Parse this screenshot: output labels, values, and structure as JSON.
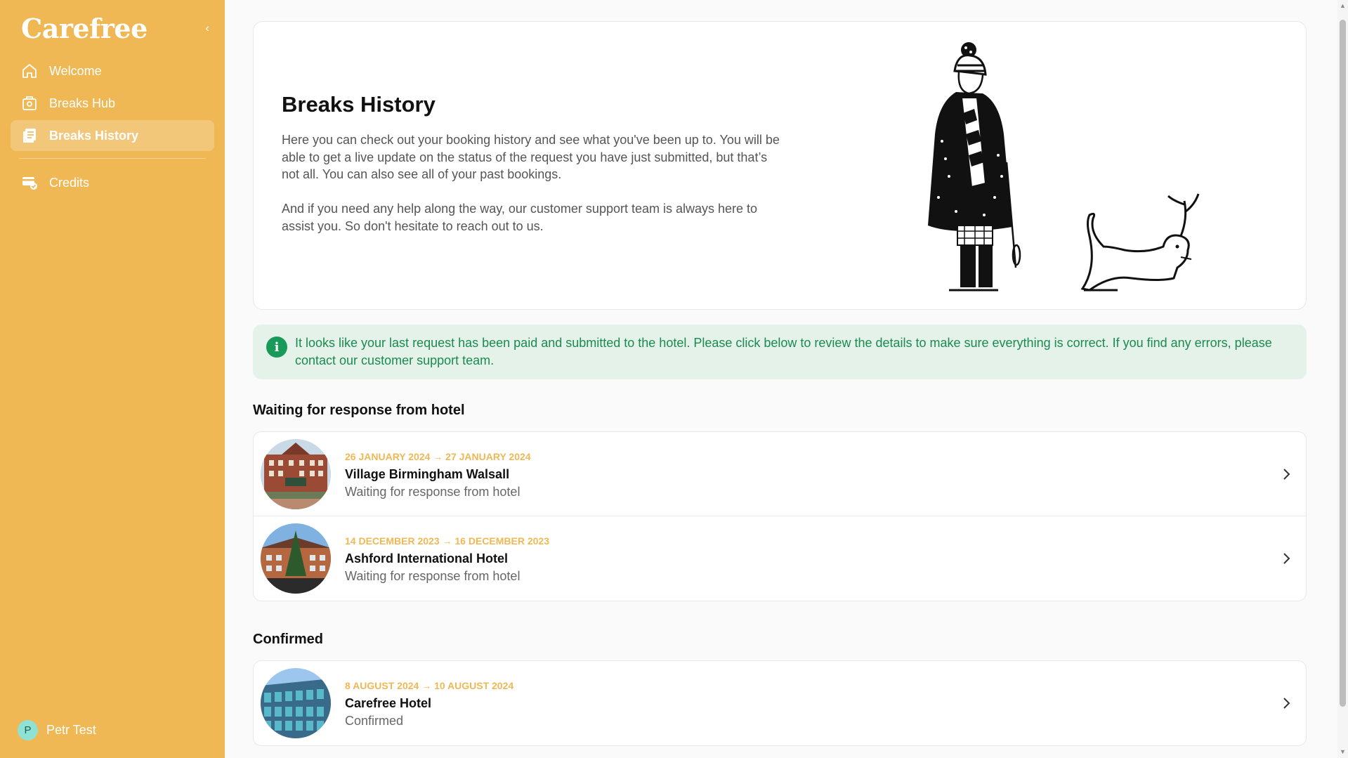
{
  "app": {
    "logo": "Carefree"
  },
  "sidebar": {
    "collapse_icon": "chevron-left-icon",
    "items": [
      {
        "label": "Welcome",
        "icon": "home-icon",
        "active": false
      },
      {
        "label": "Breaks Hub",
        "icon": "suitcase-icon",
        "active": false
      },
      {
        "label": "Breaks History",
        "icon": "history-list-icon",
        "active": true
      },
      {
        "label": "Credits",
        "icon": "credit-card-check-icon",
        "active": false
      }
    ],
    "user": {
      "initial": "P",
      "name": "Petr Test"
    }
  },
  "hero": {
    "title": "Breaks History",
    "paragraph1": "Here you can check out your booking history and see what you've been up to. You will be able to get a live update on the status of the request you have just submitted, but that’s not all. You can also see all of your past bookings.",
    "paragraph2": "And if you need any help along the way, our customer support team is always here to assist you. So don't hesitate to reach out to us."
  },
  "alert": {
    "icon": "info-icon",
    "message": "It looks like your last request has been paid and submitted to the hotel. Please click below to review the details to make sure everything is correct. If you find any errors, please contact our customer support team."
  },
  "sections": {
    "waiting": {
      "title": "Waiting for response from hotel",
      "bookings": [
        {
          "dates": "26 January 2024 → 27 January 2024",
          "name": "Village Birmingham Walsall",
          "status": "Waiting for response from hotel"
        },
        {
          "dates": "14 December 2023 → 16 December 2023",
          "name": "Ashford International Hotel",
          "status": "Waiting for response from hotel"
        }
      ]
    },
    "confirmed": {
      "title": "Confirmed",
      "bookings": [
        {
          "dates": "8 August 2024 → 10 August 2024",
          "name": "Carefree Hotel",
          "status": "Confirmed"
        }
      ]
    }
  },
  "colors": {
    "sidebar": "#efb855",
    "accent_dates": "#efb855",
    "alert_bg": "#e5f2ea",
    "alert_text": "#1a8a50"
  }
}
